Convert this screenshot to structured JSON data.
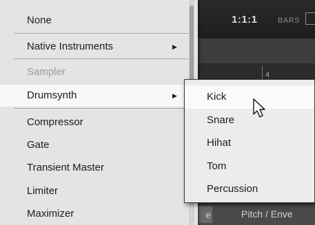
{
  "background_app": {
    "position_display": "1:1:1",
    "bars_label": "BARS",
    "ruler_number": "4",
    "bottom_left_fragment": "e",
    "bottom_label": "Pitch / Enve"
  },
  "menu": {
    "items": [
      {
        "label": "None",
        "has_submenu": false,
        "enabled": true
      },
      {
        "label": "Native Instruments",
        "has_submenu": true,
        "enabled": true
      },
      {
        "label": "Sampler",
        "has_submenu": false,
        "enabled": false
      },
      {
        "label": "Drumsynth",
        "has_submenu": true,
        "enabled": true,
        "selected": true
      },
      {
        "label": "Compressor",
        "has_submenu": false,
        "enabled": true
      },
      {
        "label": "Gate",
        "has_submenu": false,
        "enabled": true
      },
      {
        "label": "Transient Master",
        "has_submenu": false,
        "enabled": true
      },
      {
        "label": "Limiter",
        "has_submenu": false,
        "enabled": true
      },
      {
        "label": "Maximizer",
        "has_submenu": false,
        "enabled": true
      }
    ],
    "arrow_glyph": "▶"
  },
  "submenu": {
    "parent": "Drumsynth",
    "items": [
      {
        "label": "Kick",
        "hovered": true
      },
      {
        "label": "Snare"
      },
      {
        "label": "Hihat"
      },
      {
        "label": "Tom"
      },
      {
        "label": "Percussion"
      }
    ]
  },
  "colors": {
    "menu_background": "#e4e4e4",
    "submenu_background": "#ececec",
    "disabled_text": "#9a9a9a",
    "text": "#1b1b1b"
  }
}
